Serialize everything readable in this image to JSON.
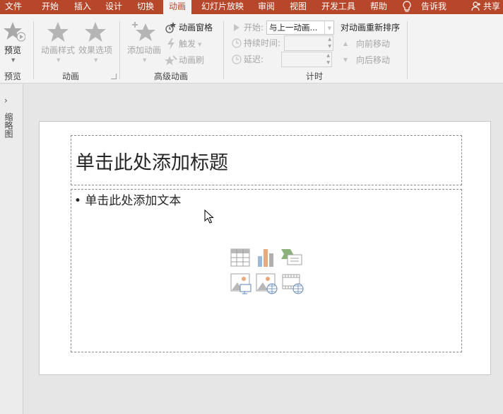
{
  "tabs": [
    "文件",
    "开始",
    "插入",
    "设计",
    "切换",
    "动画",
    "幻灯片放映",
    "审阅",
    "视图",
    "开发工具",
    "帮助",
    "告诉我",
    "共享"
  ],
  "active_tab": "动画",
  "colors": {
    "brand": "#b7472a",
    "ribbon": "#f3f3f3",
    "workspace": "#e6e6e6",
    "disabled": "#a6a6a6"
  },
  "ribbon": {
    "preview": {
      "label": "预览",
      "group": "预览"
    },
    "animation": {
      "style": "动画样式",
      "effects": "效果选项",
      "group": "动画"
    },
    "advanced": {
      "add": "添加动画",
      "pane": "动画窗格",
      "trigger": "触发",
      "painter": "动画刷",
      "group": "高级动画"
    },
    "timing": {
      "start_label": "开始:",
      "start_value": "与上一动画...",
      "duration_label": "持续时间:",
      "delay_label": "延迟:",
      "reorder": "对动画重新排序",
      "move_earlier": "向前移动",
      "move_later": "向后移动",
      "group": "计时"
    }
  },
  "outline_label": "缩略图",
  "slide": {
    "title_placeholder": "单击此处添加标题",
    "body_placeholder": "• 单击此处添加文本"
  },
  "content_icons": [
    "table-icon",
    "chart-icon",
    "smartart-icon",
    "picture-icon",
    "online-picture-icon",
    "video-icon"
  ]
}
